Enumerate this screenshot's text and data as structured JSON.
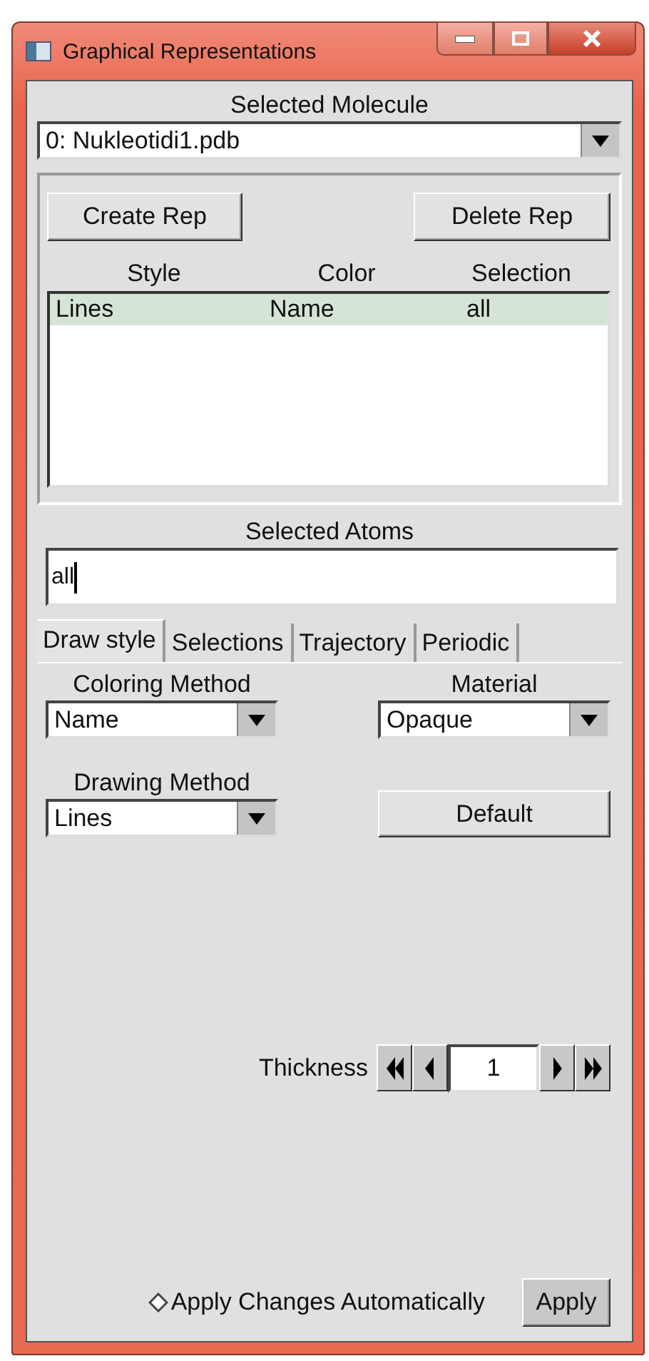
{
  "window": {
    "title": "Graphical Representations"
  },
  "molecule": {
    "label": "Selected Molecule",
    "value": "0: Nukleotidi1.pdb"
  },
  "rep_buttons": [
    "Create Rep",
    "Delete Rep"
  ],
  "table": {
    "columns": [
      "Style",
      "Color",
      "Selection"
    ],
    "rows": [
      {
        "cells": [
          "Lines",
          "Name",
          "all"
        ],
        "selected": true
      }
    ]
  },
  "atoms": {
    "label": "Selected Atoms",
    "value": "all"
  },
  "tabs": [
    {
      "label": "Draw style",
      "selected": true
    },
    {
      "label": "Selections",
      "selected": false
    },
    {
      "label": "Trajectory",
      "selected": false
    },
    {
      "label": "Periodic",
      "selected": false
    }
  ],
  "coloring": {
    "label": "Coloring Method",
    "value": "Name"
  },
  "material": {
    "label": "Material",
    "value": "Opaque"
  },
  "drawing": {
    "label": "Drawing Method",
    "value": "Lines"
  },
  "default_button": "Default",
  "thickness": {
    "label": "Thickness",
    "value": "1"
  },
  "auto_apply": {
    "label": "Apply Changes Automatically",
    "checked": false
  },
  "apply_button": "Apply"
}
